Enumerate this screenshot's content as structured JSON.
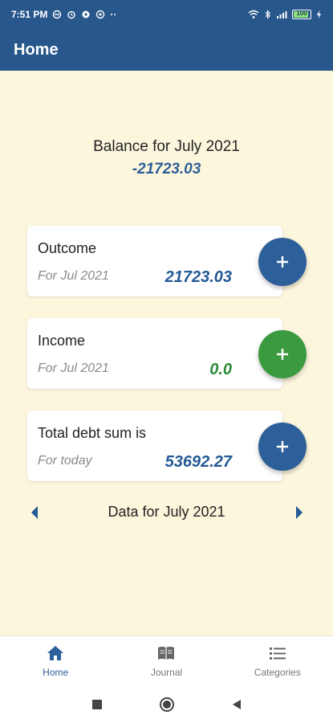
{
  "status_bar": {
    "time": "7:51 PM",
    "notification_icons": [
      "sync-icon",
      "alarm-icon",
      "settings-icon",
      "vpn-icon"
    ],
    "extra": "··",
    "battery": "100"
  },
  "app_bar": {
    "title": "Home"
  },
  "balance": {
    "label": "Balance for July 2021",
    "value": "-21723.03"
  },
  "cards": {
    "outcome": {
      "title": "Outcome",
      "subtitle": "For Jul 2021",
      "value": "21723.03",
      "color": "#245a96",
      "fab_color": "#2d5f9a"
    },
    "income": {
      "title": "Income",
      "subtitle": "For Jul 2021",
      "value": "0.0",
      "color": "#2e8b3a",
      "fab_color": "#3a9a3f"
    },
    "debt": {
      "title": "Total debt sum is",
      "subtitle": "For today",
      "value": "53692.27",
      "color": "#245a96",
      "fab_color": "#2d5f9a"
    }
  },
  "month_nav": {
    "label": "Data for July 2021"
  },
  "bottom_nav": {
    "items": [
      {
        "label": "Home",
        "icon": "home-icon",
        "active": true
      },
      {
        "label": "Journal",
        "icon": "book-icon",
        "active": false
      },
      {
        "label": "Categories",
        "icon": "list-icon",
        "active": false
      }
    ]
  },
  "colors": {
    "primary": "#28578c",
    "background": "#fcf6dd",
    "accent_blue": "#2d5f9a",
    "accent_green": "#3a9a3f"
  }
}
